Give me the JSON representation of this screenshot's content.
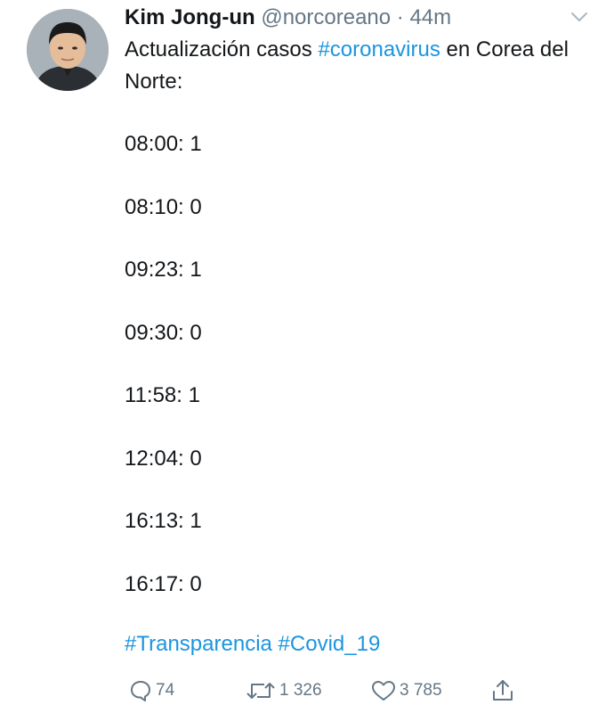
{
  "tweet": {
    "author_name": "Kim Jong-un",
    "handle": "@norcoreano",
    "separator": "·",
    "time": "44m",
    "text_prefix": "Actualización casos ",
    "hashtag_main": "#coronavirus",
    "text_suffix": " en Corea del Norte:",
    "entries": [
      "08:00: 1",
      "08:10: 0",
      "09:23: 1",
      "09:30: 0",
      "11:58: 1",
      "12:04: 0",
      "16:13: 1",
      "16:17: 0"
    ],
    "hashtag_1": "#Transparencia",
    "hashtag_2": "#Covid_19",
    "link_color": "#1b95e0",
    "secondary_color": "#657786"
  },
  "actions": {
    "reply_icon": "reply-bubble-icon",
    "reply_count": "74",
    "retweet_icon": "retweet-arrows-icon",
    "retweet_count": "1 326",
    "like_icon": "heart-icon",
    "like_count": "3 785",
    "share_icon": "share-upload-icon"
  },
  "menu_icon": "chevron-down-icon"
}
